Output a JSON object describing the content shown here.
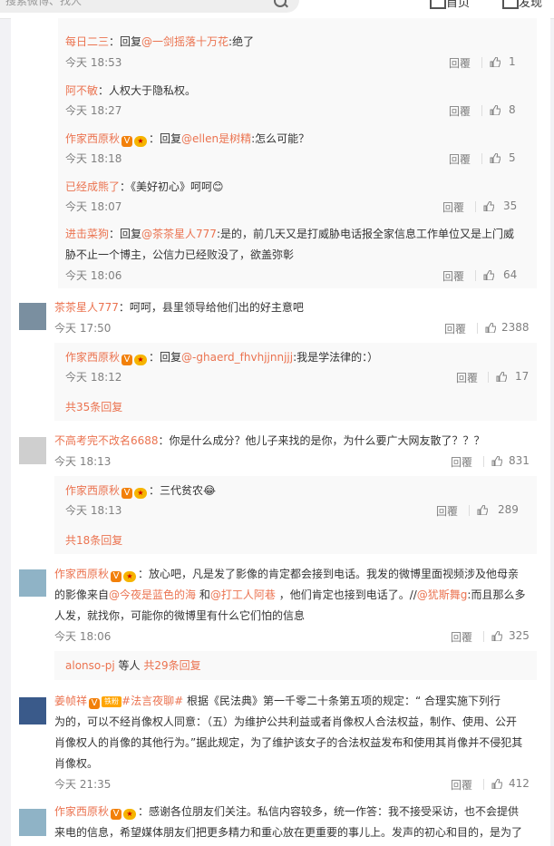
{
  "search": {
    "placeholder": "搜索微博、找人"
  },
  "nav": {
    "home": "首页",
    "discover": "发现"
  },
  "comments": [
    {
      "user": "每日二三",
      "text_pre": "：回复",
      "mention": "@一剑摇落十万花",
      "text_post": ":绝了",
      "time": "今天 18:53",
      "reply": "回覆",
      "likes": "1"
    },
    {
      "user": "阿不敏",
      "text": "：人权大于隐私权。",
      "time": "今天 18:27",
      "reply": "回覆",
      "likes": "8"
    },
    {
      "user": "作家西原秋",
      "text_pre": "：回复",
      "mention": "@ellen是树精",
      "text_post": ":怎么可能？",
      "time": "今天 18:18",
      "reply": "回覆",
      "likes": "5"
    },
    {
      "user": "已经成熊了",
      "text": "：《美好初心》呵呵😊",
      "time": "今天 18:07",
      "reply": "回覆",
      "likes": "35"
    },
    {
      "user": "进击菜狗",
      "text_pre": "：回复",
      "mention": "@茶茶星人777",
      "text_post": ":是的，前几天又是打威胁电话报全家信息工作单位又是上门威",
      "text_line2": "胁不止一个博主，公信力已经败没了，欲盖弥彰",
      "time": "今天 18:06",
      "reply": "回覆",
      "likes": "64"
    }
  ],
  "thread1": {
    "user": "茶茶星人777",
    "text": "：呵呵，县里领导给他们出的好主意吧",
    "time": "今天 17:50",
    "reply": "回覆",
    "likes": "2388",
    "sub": {
      "user": "作家西原秋",
      "text_pre": "：回复",
      "mention": "@-ghaerd_fhvhjjnnjjj",
      "text_post": ":我是学法律的：）",
      "time": "今天 18:12",
      "reply": "回覆",
      "likes": "17"
    },
    "more": "共35条回复"
  },
  "thread2": {
    "user": "不高考完不改名6688",
    "text": "：你是什么成分？他儿子来找的是你，为什么要广大网友散了？？？",
    "time": "今天 18:13",
    "reply": "回覆",
    "likes": "831",
    "sub": {
      "user": "作家西原秋",
      "text": "：三代贫农😂",
      "time": "今天 18:13",
      "reply": "回覆",
      "likes": "289"
    },
    "more": "共18条回复"
  },
  "thread3": {
    "user": "作家西原秋",
    "line1": "：放心吧，凡是发了影像的肯定都会接到电话。我发的微博里面视频涉及他母亲",
    "line2_pre": "的影像来自",
    "line2_m1": "@今夜是蓝色的海",
    "line2_mid": " 和",
    "line2_m2": "@打工人阿巷",
    "line2_post": " ，他们肯定也接到电话了。//",
    "line2_m3": "@犹斯舞g",
    "line2_end": ":而且那么多",
    "line3": "人发，就找你，可能你的微博里有什么它们怕的信息",
    "time": "今天 18:06",
    "reply": "回覆",
    "likes": "325",
    "more_user": "alonso-pj",
    "more_mid": " 等人 ",
    "more": "共29条回复"
  },
  "thread4": {
    "user": "姜帧祥",
    "fan_badge": "铁粉",
    "hashtag": "#法言夜聊#",
    "line1": " 根据《民法典》第一千零二十条第五项的规定：“ 合理实施下列行",
    "line2": "为的，可以不经肖像权人同意：（五）为维护公共利益或者肖像权人合法权益，制作、使用、公开",
    "line3": "肖像权人的肖像的其他行为。”据此规定，为了维护该女子的合法权益发布和使用其肖像并不侵犯其",
    "line4": "肖像权。",
    "time": "今天 21:35",
    "reply": "回覆",
    "likes": "412"
  },
  "thread5": {
    "user": "作家西原秋",
    "line1": "：感谢各位朋友们关注。私信内容较多，统一作答：我不接受采访，也不会提供",
    "line2": "来电的信息，希望媒体朋友们把更多精力和重心放在更重要的事儿上。发声的初心和目的，是为了"
  }
}
